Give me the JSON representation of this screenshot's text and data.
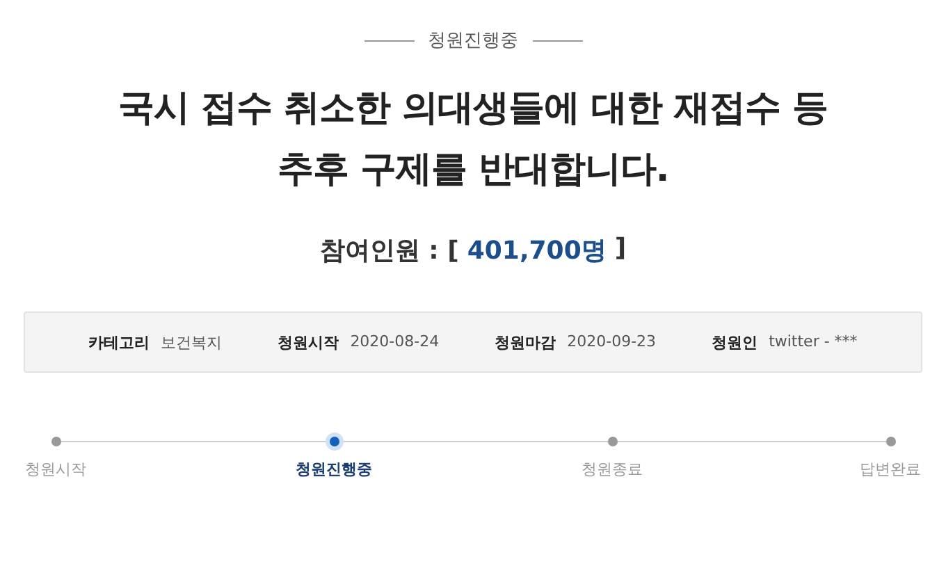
{
  "status_label": "청원진행중",
  "title_lines": [
    "국시 접수 취소한 의대생들에 대한 재접수 등",
    "추후 구제를 반대합니다."
  ],
  "participants": {
    "label": "참여인원 : [",
    "count": "401,700명",
    "close": "]"
  },
  "info": [
    {
      "label": "카테고리",
      "value": "보건복지"
    },
    {
      "label": "청원시작",
      "value": "2020-08-24"
    },
    {
      "label": "청원마감",
      "value": "2020-09-23"
    },
    {
      "label": "청원인",
      "value": "twitter - ***"
    }
  ],
  "steps": [
    {
      "label": "청원시작",
      "selected": false
    },
    {
      "label": "청원진행중",
      "selected": true
    },
    {
      "label": "청원종료",
      "selected": false
    },
    {
      "label": "답변완료",
      "selected": false
    }
  ]
}
